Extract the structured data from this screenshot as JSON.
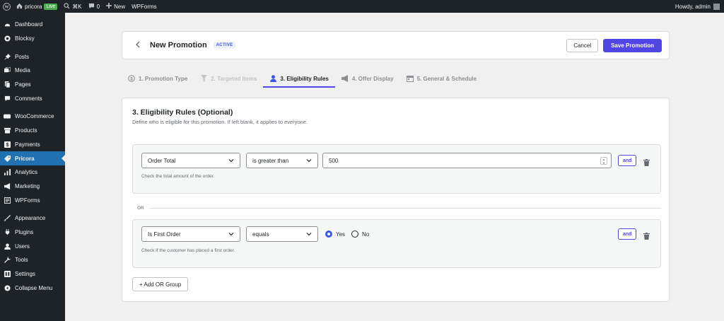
{
  "adminbar": {
    "site_name": "pricora",
    "live_badge": "Live",
    "shortcut": "⌘K",
    "comments_count": "0",
    "new_label": "New",
    "wpforms_label": "WPForms",
    "greeting": "Howdy, admin"
  },
  "sidebar": {
    "items": [
      {
        "label": "Dashboard",
        "icon": "dashboard-icon"
      },
      {
        "label": "Blocksy",
        "icon": "blocksy-icon"
      },
      {
        "label": "Posts",
        "icon": "pin-icon"
      },
      {
        "label": "Media",
        "icon": "media-icon"
      },
      {
        "label": "Pages",
        "icon": "page-icon"
      },
      {
        "label": "Comments",
        "icon": "comment-icon"
      },
      {
        "label": "WooCommerce",
        "icon": "woo-icon"
      },
      {
        "label": "Products",
        "icon": "archive-icon"
      },
      {
        "label": "Payments",
        "icon": "dollar-icon"
      },
      {
        "label": "Pricora",
        "icon": "tag-icon"
      },
      {
        "label": "Analytics",
        "icon": "bar-chart-icon"
      },
      {
        "label": "Marketing",
        "icon": "megaphone-icon"
      },
      {
        "label": "WPForms",
        "icon": "form-icon"
      },
      {
        "label": "Appearance",
        "icon": "brush-icon"
      },
      {
        "label": "Plugins",
        "icon": "plug-icon"
      },
      {
        "label": "Users",
        "icon": "user-icon"
      },
      {
        "label": "Tools",
        "icon": "wrench-icon"
      },
      {
        "label": "Settings",
        "icon": "settings-icon"
      },
      {
        "label": "Collapse Menu",
        "icon": "collapse-icon"
      }
    ]
  },
  "header": {
    "back_icon": "chevron-left-icon",
    "title": "New Promotion",
    "status": "ACTIVE",
    "cancel_label": "Cancel",
    "save_label": "Save Promotion"
  },
  "tabs": [
    {
      "label": "1. Promotion Type",
      "icon": "dollar-circle-icon",
      "state": "inactive"
    },
    {
      "label": "2. Targeted Items",
      "icon": "filter-icon",
      "state": "disabled"
    },
    {
      "label": "3. Eligibility Rules",
      "icon": "user-icon",
      "state": "active"
    },
    {
      "label": "4. Offer Display",
      "icon": "megaphone-icon",
      "state": "inactive"
    },
    {
      "label": "5. General & Schedule",
      "icon": "calendar-icon",
      "state": "inactive"
    }
  ],
  "section": {
    "title": "3. Eligibility Rules (Optional)",
    "description": "Define who is eligible for this promotion. If left blank, it applies to everyone."
  },
  "groups": [
    {
      "field": "Order Total",
      "operator": "is greater than",
      "value": "500",
      "and_label": "and",
      "help": "Check the total amount of the order."
    },
    {
      "field": "Is First Order",
      "operator": "equals",
      "options": [
        {
          "label": "Yes",
          "checked": true
        },
        {
          "label": "No",
          "checked": false
        }
      ],
      "and_label": "and",
      "help": "Check if the customer has placed a first order."
    }
  ],
  "or_label": "OR",
  "add_or_group_label": "+ Add OR Group",
  "colors": {
    "accent": "#4f46e5",
    "sidebar_bg": "#1d2327",
    "sidebar_active": "#2271b1",
    "radio_checked": "#3858e9"
  }
}
